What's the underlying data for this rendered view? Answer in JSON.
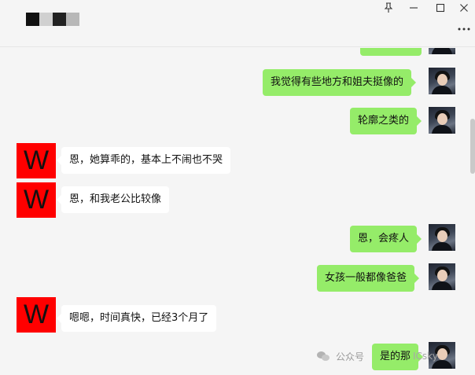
{
  "window": {
    "title_blocks": [
      "#111111",
      "#d0d0d0",
      "#222222",
      "#b8b8b8"
    ],
    "pin_icon": "pin-icon",
    "minimize_icon": "minimize-icon",
    "maximize_icon": "maximize-icon",
    "close_icon": "close-icon",
    "more_icon": "more-icon"
  },
  "colors": {
    "sent_bubble": "#95ec69",
    "received_bubble": "#ffffff",
    "received_avatar": "#ff0000"
  },
  "messages": [
    {
      "side": "right",
      "text": ""
    },
    {
      "side": "right",
      "text": "我觉得有些地方和姐夫挺像的"
    },
    {
      "side": "right",
      "text": "轮廓之类的"
    },
    {
      "side": "left",
      "text": "恩，她算乖的，基本上不闹也不哭",
      "avatar_letter": "W"
    },
    {
      "side": "left",
      "text": "恩，和我老公比较像",
      "avatar_letter": "W"
    },
    {
      "side": "right",
      "text": "恩，会疼人"
    },
    {
      "side": "right",
      "text": "女孩一般都像爸爸"
    },
    {
      "side": "left",
      "text": "嗯嗯，时间真快，已经3个月了",
      "avatar_letter": "W"
    },
    {
      "side": "right",
      "text": "是的那"
    }
  ],
  "watermark": {
    "text": "公众号",
    "suffix": "ICsky"
  }
}
